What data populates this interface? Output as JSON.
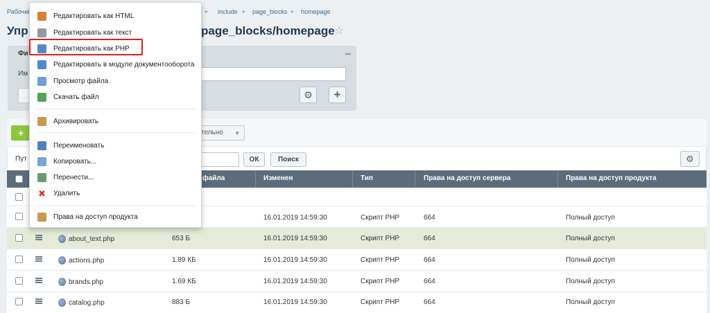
{
  "breadcrumb": [
    "Рабочий",
    "include",
    "page_blocks",
    "homepage"
  ],
  "page_title_start": "Упр",
  "page_title_end": "page_blocks/homepage",
  "filter": {
    "tab_label": "Фи",
    "name_label": "Им",
    "input_value": ""
  },
  "toolbar": {
    "add_label": "+",
    "more_label": "тельно"
  },
  "path_row": {
    "label": "Пут",
    "input_value": "",
    "ok_label": "ОК",
    "search_label": "Поиск"
  },
  "columns": [
    "файла",
    "Изменен",
    "Тип",
    "Права на доступ сервера",
    "Права на доступ продукта"
  ],
  "rows": [
    {
      "name": "",
      "size": "",
      "modified": "16.01.2019 14:59:30",
      "type": "Скрипт PHP",
      "server_rights": "664",
      "product_rights": "Полный доступ"
    },
    {
      "name": "about_text.php",
      "size": "653 Б",
      "modified": "16.01.2019 14:59:30",
      "type": "Скрипт PHP",
      "server_rights": "664",
      "product_rights": "Полный доступ"
    },
    {
      "name": "actions.php",
      "size": "1.89 КБ",
      "modified": "16.01.2019 14:59:30",
      "type": "Скрипт PHP",
      "server_rights": "664",
      "product_rights": "Полный доступ"
    },
    {
      "name": "brands.php",
      "size": "1.69 КБ",
      "modified": "16.01.2019 14:59:30",
      "type": "Скрипт PHP",
      "server_rights": "664",
      "product_rights": "Полный доступ"
    },
    {
      "name": "catalog.php",
      "size": "883 Б",
      "modified": "16.01.2019 14:59:30",
      "type": "Скрипт PHP",
      "server_rights": "664",
      "product_rights": "Полный доступ"
    }
  ],
  "context_menu": [
    {
      "label": "Редактировать как HTML",
      "icon": "html-edit-icon",
      "color": "#d9822b"
    },
    {
      "label": "Редактировать как текст",
      "icon": "text-edit-icon",
      "color": "#8f99a3"
    },
    {
      "label": "Редактировать как PHP",
      "icon": "php-edit-icon",
      "color": "#5b86c4"
    },
    {
      "label": "Редактировать в модуле документооборота",
      "icon": "workflow-edit-icon",
      "color": "#4f89c9"
    },
    {
      "label": "Просмотр файла",
      "icon": "view-file-icon",
      "color": "#6f9fd8"
    },
    {
      "label": "Скачать файл",
      "icon": "download-file-icon",
      "color": "#57a05a"
    },
    {
      "label": "Архивировать",
      "icon": "archive-icon",
      "color": "#c79a4b"
    },
    {
      "label": "Переименовать",
      "icon": "rename-icon",
      "color": "#4f7fbf"
    },
    {
      "label": "Копировать...",
      "icon": "copy-icon",
      "color": "#7aa3d6"
    },
    {
      "label": "Перенести...",
      "icon": "move-icon",
      "color": "#6b9a6e"
    },
    {
      "label": "Удалить",
      "icon": "delete-icon",
      "color": "#d83a2e"
    },
    {
      "label": "Права на доступ продукта",
      "icon": "access-rights-icon",
      "color": "#c99a4d"
    }
  ],
  "colors": {
    "header_bg": "#5b6c7c",
    "add_button": "#8dc63f",
    "highlight_border": "#e01f1f",
    "hover_row": "#e5ebd8"
  }
}
